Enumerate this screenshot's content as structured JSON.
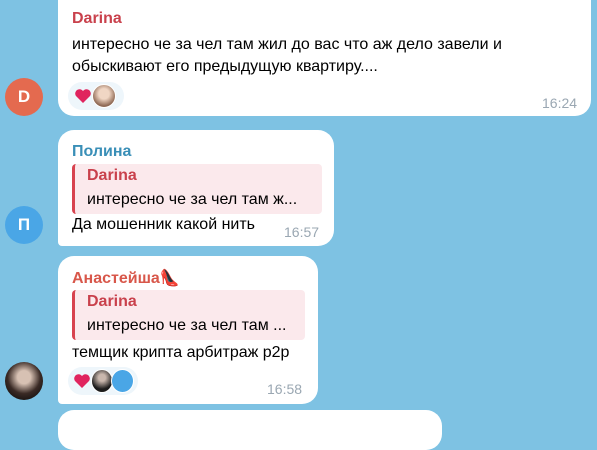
{
  "messages": [
    {
      "sender": "Darina",
      "sender_color": "#c9414c",
      "avatar_letter": "D",
      "avatar_color": "#e46a4f",
      "text_line1": "интересно че за чел там жил до вас что аж дело завели и",
      "text_line2": "обыскивают его предыдущую квартиру....",
      "reaction_icon": "heart-icon",
      "time": "16:24"
    },
    {
      "sender": "Полина",
      "sender_color": "#3a8fb7",
      "avatar_letter": "П",
      "avatar_color": "#4aa6e6",
      "reply_name": "Darina",
      "reply_text": "интересно че за чел там ж...",
      "text": "Да мошенник какой нить",
      "time": "16:57"
    },
    {
      "sender": "Анастейша",
      "sender_emoji": "👠",
      "sender_color": "#d8574a",
      "reply_name": "Darina",
      "reply_text": "интересно че за чел там ...",
      "text": "темщик крипта арбитраж р2р",
      "reaction_icon": "heart-icon",
      "time": "16:58"
    }
  ]
}
